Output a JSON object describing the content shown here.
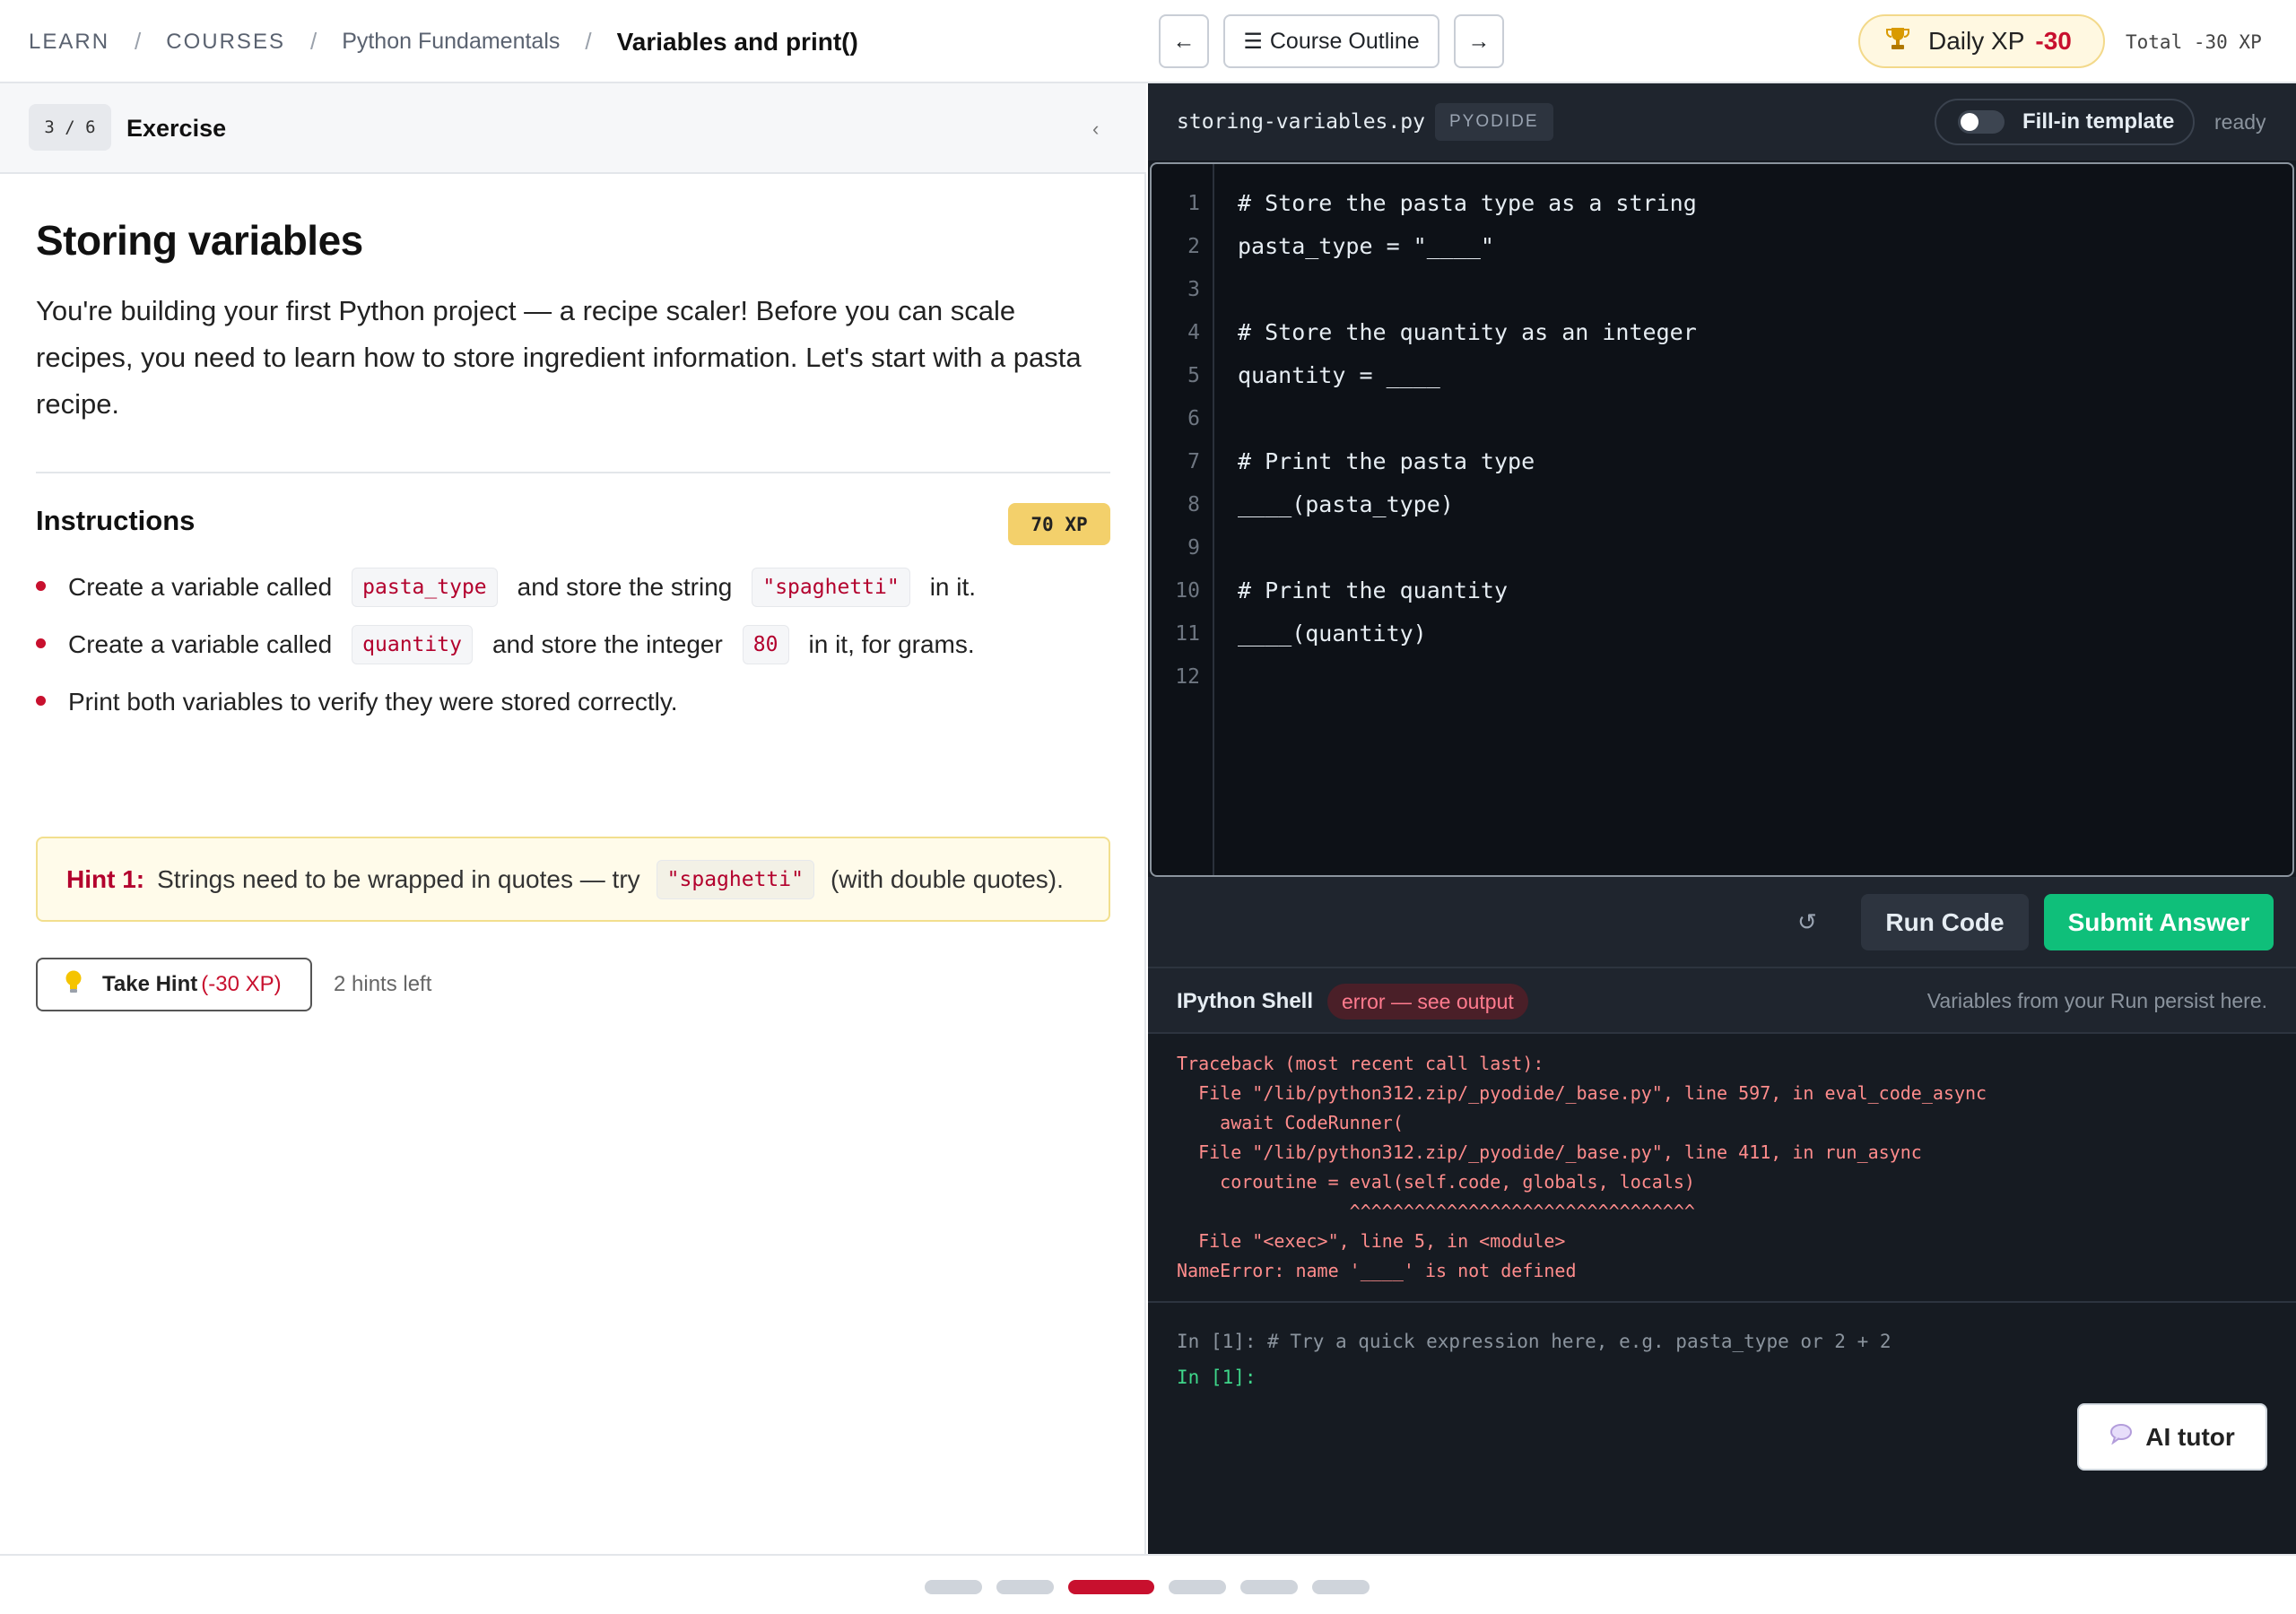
{
  "breadcrumb": {
    "items": [
      "LEARN",
      "COURSES",
      "Python Fundamentals"
    ],
    "current": "Variables and print()"
  },
  "header": {
    "prev_glyph": "←",
    "next_glyph": "→",
    "outline_glyph": "☰",
    "outline_label": "Course Outline",
    "daily_xp_label": "Daily XP",
    "daily_xp_value": "-30",
    "total_xp": "Total -30 XP"
  },
  "exercise": {
    "counter": "3 / 6",
    "type": "Exercise",
    "collapse_glyph": "‹",
    "title": "Storing variables",
    "intro": "You're building your first Python project — a recipe scaler! Before you can scale recipes, you need to learn how to store ingredient information. Let's start with a pasta recipe.",
    "instructions_heading": "Instructions",
    "xp": "70 XP",
    "instructions": [
      {
        "a": "Create a variable called",
        "code1": "pasta_type",
        "b": "and store the string",
        "code2": "\"spaghetti\"",
        "c": "in it."
      },
      {
        "a": "Create a variable called",
        "code1": "quantity",
        "b": "and store the integer",
        "code2": "80",
        "c": "in it, for grams."
      },
      {
        "a": "Print both variables to verify they were stored correctly."
      }
    ],
    "hint": {
      "label": "Hint 1:",
      "text_before": "Strings need to be wrapped in quotes — try",
      "code": "\"spaghetti\"",
      "text_after": "(with double quotes)."
    },
    "take_hint_label": "Take Hint",
    "take_hint_cost": "(-30 XP)",
    "hints_left": "2 hints left"
  },
  "editor": {
    "filename": "storing-variables.py",
    "runtime": "PYODIDE",
    "template_toggle_label": "Fill-in template",
    "template_toggle_on": false,
    "status": "ready",
    "lines": [
      {
        "n": "1",
        "code": "# Store the pasta type as a string"
      },
      {
        "n": "2",
        "code": "pasta_type = \"____\""
      },
      {
        "n": "3",
        "code": ""
      },
      {
        "n": "4",
        "code": "# Store the quantity as an integer"
      },
      {
        "n": "5",
        "code": "quantity = ____"
      },
      {
        "n": "6",
        "code": ""
      },
      {
        "n": "7",
        "code": "# Print the pasta type"
      },
      {
        "n": "8",
        "code": "____(pasta_type)"
      },
      {
        "n": "9",
        "code": ""
      },
      {
        "n": "10",
        "code": "# Print the quantity"
      },
      {
        "n": "11",
        "code": "____(quantity)"
      },
      {
        "n": "12",
        "code": ""
      }
    ],
    "reset_glyph": "↺",
    "run_label": "Run Code",
    "submit_label": "Submit Answer"
  },
  "shell": {
    "title": "IPython Shell",
    "status": "error — see output",
    "note": "Variables from your Run persist here.",
    "traceback": [
      "Traceback (most recent call last):",
      "  File \"/lib/python312.zip/_pyodide/_base.py\", line 597, in eval_code_async",
      "    await CodeRunner(",
      "  File \"/lib/python312.zip/_pyodide/_base.py\", line 411, in run_async",
      "    coroutine = eval(self.code, globals, locals)",
      "                ^^^^^^^^^^^^^^^^^^^^^^^^^^^^^^^^",
      "  File \"<exec>\", line 5, in <module>",
      "NameError: name '____' is not defined"
    ],
    "history_prompt": "In [1]: # Try a quick expression here, e.g. pasta_type or 2 + 2",
    "live_prompt": "In [1]:"
  },
  "ai_tutor": {
    "label": "AI tutor",
    "glyph": "💬"
  },
  "progress": {
    "total": 6,
    "current": 3
  },
  "colors": {
    "accent": "#c8102e",
    "submit": "#0fbf7a",
    "editor_bg": "#0d1117",
    "panel_bg": "#161b22"
  }
}
